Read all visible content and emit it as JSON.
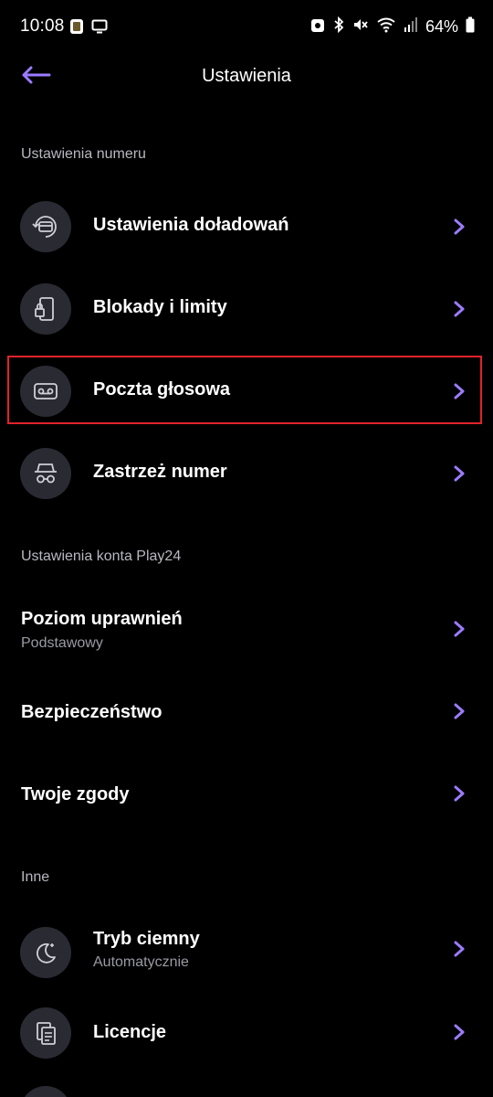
{
  "status_bar": {
    "time": "10:08",
    "battery": "64%"
  },
  "header": {
    "title": "Ustawienia"
  },
  "sections": {
    "number": {
      "title": "Ustawienia numeru",
      "items": [
        {
          "label": "Ustawienia doładowań",
          "icon": "topup-icon"
        },
        {
          "label": "Blokady i limity",
          "icon": "phone-lock-icon"
        },
        {
          "label": "Poczta głosowa",
          "icon": "voicemail-icon"
        },
        {
          "label": "Zastrzeż numer",
          "icon": "incognito-icon"
        }
      ]
    },
    "account": {
      "title": "Ustawienia konta Play24",
      "items": [
        {
          "label": "Poziom uprawnień",
          "sub": "Podstawowy"
        },
        {
          "label": "Bezpieczeństwo"
        },
        {
          "label": "Twoje zgody"
        }
      ]
    },
    "other": {
      "title": "Inne",
      "items": [
        {
          "label": "Tryb ciemny",
          "sub": "Automatycznie",
          "icon": "moon-icon"
        },
        {
          "label": "Licencje",
          "icon": "document-icon"
        }
      ]
    }
  },
  "colors": {
    "accent": "#9b7cff",
    "background": "#000000",
    "icon_bg": "#2a2a33",
    "highlight": "#e2222b"
  }
}
